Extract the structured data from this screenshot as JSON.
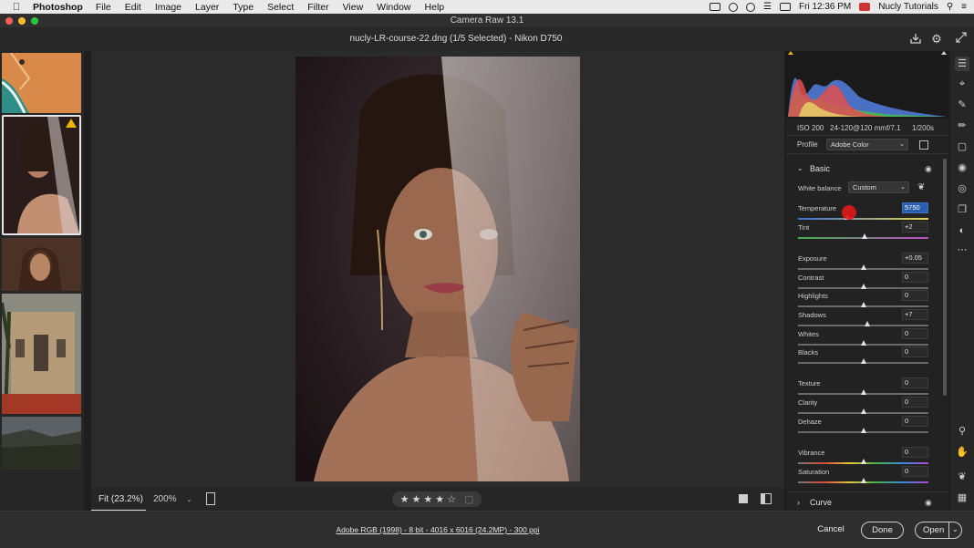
{
  "menubar": {
    "app_name": "Photoshop",
    "menus": [
      "File",
      "Edit",
      "Image",
      "Layer",
      "Type",
      "Select",
      "Filter",
      "View",
      "Window",
      "Help"
    ],
    "clock": "Fri 12:36 PM",
    "user": "Nucly Tutorials"
  },
  "window": {
    "title": "Camera Raw 13.1"
  },
  "header": {
    "file_title": "nucly-LR-course-22.dng (1/5 Selected)  -  Nikon D750"
  },
  "filmstrip": {
    "selected_index": 1,
    "count": 5
  },
  "bottombar": {
    "fit_label": "Fit (23.2%)",
    "zoom_label": "200%"
  },
  "panel": {
    "exif": {
      "iso": "ISO 200",
      "lens": "24-120@120 mm",
      "aperture": "f/7.1",
      "shutter": "1/200s"
    },
    "profile": {
      "label": "Profile",
      "value": "Adobe Color"
    },
    "basic": {
      "title": "Basic",
      "white_balance": {
        "label": "White balance",
        "value": "Custom"
      },
      "sliders": [
        {
          "label": "Temperature",
          "value": "5750",
          "level": 0.38
        },
        {
          "label": "Tint",
          "value": "+2",
          "level": 0.51
        },
        {
          "label": "Exposure",
          "value": "+0.05",
          "level": 0.5
        },
        {
          "label": "Contrast",
          "value": "0",
          "level": 0.5
        },
        {
          "label": "Highlights",
          "value": "0",
          "level": 0.5
        },
        {
          "label": "Shadows",
          "value": "+7",
          "level": 0.53
        },
        {
          "label": "Whites",
          "value": "0",
          "level": 0.5
        },
        {
          "label": "Blacks",
          "value": "0",
          "level": 0.5
        },
        {
          "label": "Texture",
          "value": "0",
          "level": 0.5
        },
        {
          "label": "Clarity",
          "value": "0",
          "level": 0.5
        },
        {
          "label": "Dehaze",
          "value": "0",
          "level": 0.5
        },
        {
          "label": "Vibrance",
          "value": "0",
          "level": 0.5
        },
        {
          "label": "Saturation",
          "value": "0",
          "level": 0.5
        }
      ]
    },
    "curve": {
      "title": "Curve"
    }
  },
  "footer": {
    "workflow_info": "Adobe RGB (1998) - 8 bit - 4016 x 6016 (24.2MP) - 300 ppi",
    "cancel_label": "Cancel",
    "done_label": "Done",
    "open_label": "Open"
  },
  "colors": {
    "accent_highlight": "#2b5fad",
    "warning": "#f0b400",
    "cursor": "#e01818"
  }
}
